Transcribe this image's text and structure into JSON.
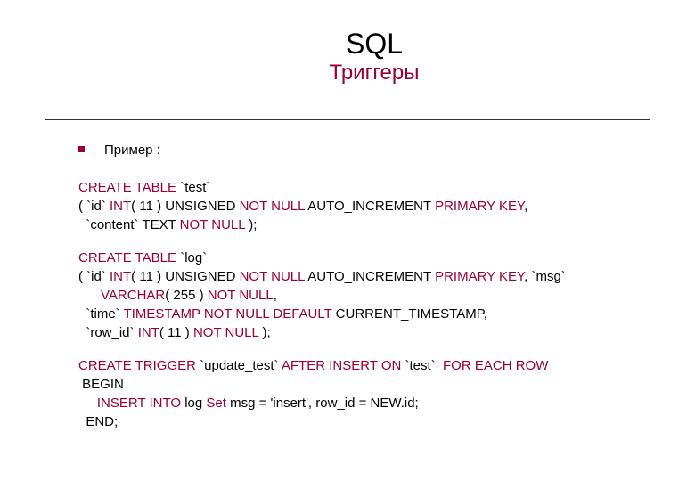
{
  "title": {
    "main": "SQL",
    "sub": "Триггеры"
  },
  "bullet": {
    "label": "Пример :"
  },
  "block1": {
    "l1a": "CREATE TABLE",
    "l1b": " `test`",
    "l2a": "( `id` ",
    "l2b": "INT",
    "l2c": "( 11 ) UNSIGNED ",
    "l2d": "NOT NULL",
    "l2e": " AUTO_INCREMENT ",
    "l2f": "PRIMARY KEY",
    "l2g": ",",
    "l3a": "  `content` TEXT ",
    "l3b": "NOT NULL",
    "l3c": " );"
  },
  "block2": {
    "l1a": "CREATE TABLE",
    "l1b": " `log`",
    "l2a": "( `id` ",
    "l2b": "INT",
    "l2c": "( 11 ) UNSIGNED ",
    "l2d": "NOT NULL",
    "l2e": " AUTO_INCREMENT ",
    "l2f": "PRIMARY KEY",
    "l2g": ", `msg`",
    "l3a": "      ",
    "l3b": "VARCHAR",
    "l3c": "( 255 ) ",
    "l3d": "NOT NULL",
    "l3e": ",",
    "l4a": "  `time` ",
    "l4b": "TIMESTAMP NOT NULL DEFAULT",
    "l4c": " CURRENT_TIMESTAMP,",
    "l5a": "  `row_id` ",
    "l5b": "INT",
    "l5c": "( 11 ) ",
    "l5d": "NOT NULL",
    "l5e": " );"
  },
  "block3": {
    "l1a": "CREATE TRIGGER",
    "l1b": " `update_test` ",
    "l1c": "AFTER INSERT ON",
    "l1d": " `test`  ",
    "l1e": "FOR EACH ROW",
    "l2": " BEGIN",
    "l3a": "     ",
    "l3b": "INSERT INTO",
    "l3c": " log ",
    "l3d": "Set",
    "l3e": " msg = 'insert', row_id = NEW.id;",
    "l4": "  END;"
  }
}
